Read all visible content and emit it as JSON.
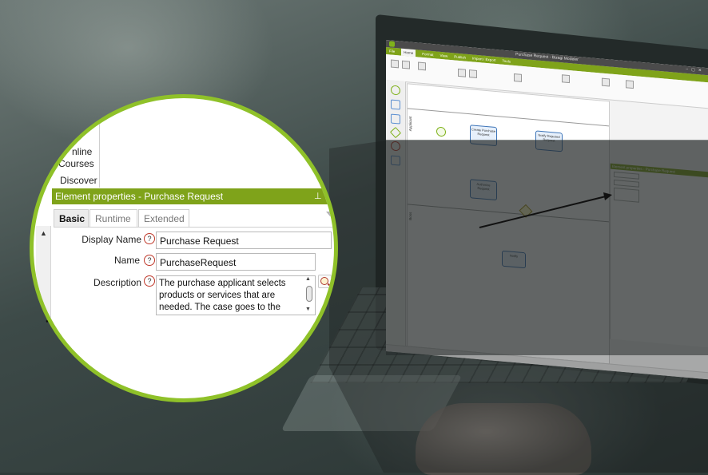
{
  "zoom_panel": {
    "nav": {
      "online_line1": "nline",
      "online_line2": "Courses",
      "discover": "Discover"
    },
    "panel_title": "Element properties - Purchase Request",
    "tabs": [
      {
        "label": "Basic",
        "active": true
      },
      {
        "label": "Runtime",
        "active": false
      },
      {
        "label": "Extended",
        "active": false
      }
    ],
    "fields": {
      "display_name": {
        "label": "Display Name",
        "value": "Purchase Request"
      },
      "name": {
        "label": "Name",
        "value": "PurchaseRequest"
      },
      "description": {
        "label": "Description",
        "value": "The purchase applicant selects products or services that are needed. The case goes to the"
      }
    },
    "help_glyph": "?"
  },
  "laptop_app": {
    "window_title": "Purchase Request - Bizagi Modeler",
    "menu_tabs": [
      "File",
      "Home",
      "Format",
      "View",
      "Publish",
      "Import / Export",
      "Tools"
    ],
    "lanes": [
      "Applicant",
      "Boss"
    ],
    "tasks": [
      "Create Purchase Request",
      "Notify Rejected Request",
      "Authorize Request",
      "Notify"
    ],
    "start_event": "Start",
    "props_panel": {
      "title": "Element properties - Purchase Request",
      "tabs": [
        "Basic",
        "Runtime",
        "Extended"
      ],
      "display_name": "Purchase Request",
      "name": "PurchaseRequest",
      "description": "The purchase applicant selects products or services that are needed. The case goes to the"
    }
  },
  "colors": {
    "accent_green": "#7fa31a",
    "ring_green": "#8fc129",
    "help_red": "#c0392b"
  }
}
